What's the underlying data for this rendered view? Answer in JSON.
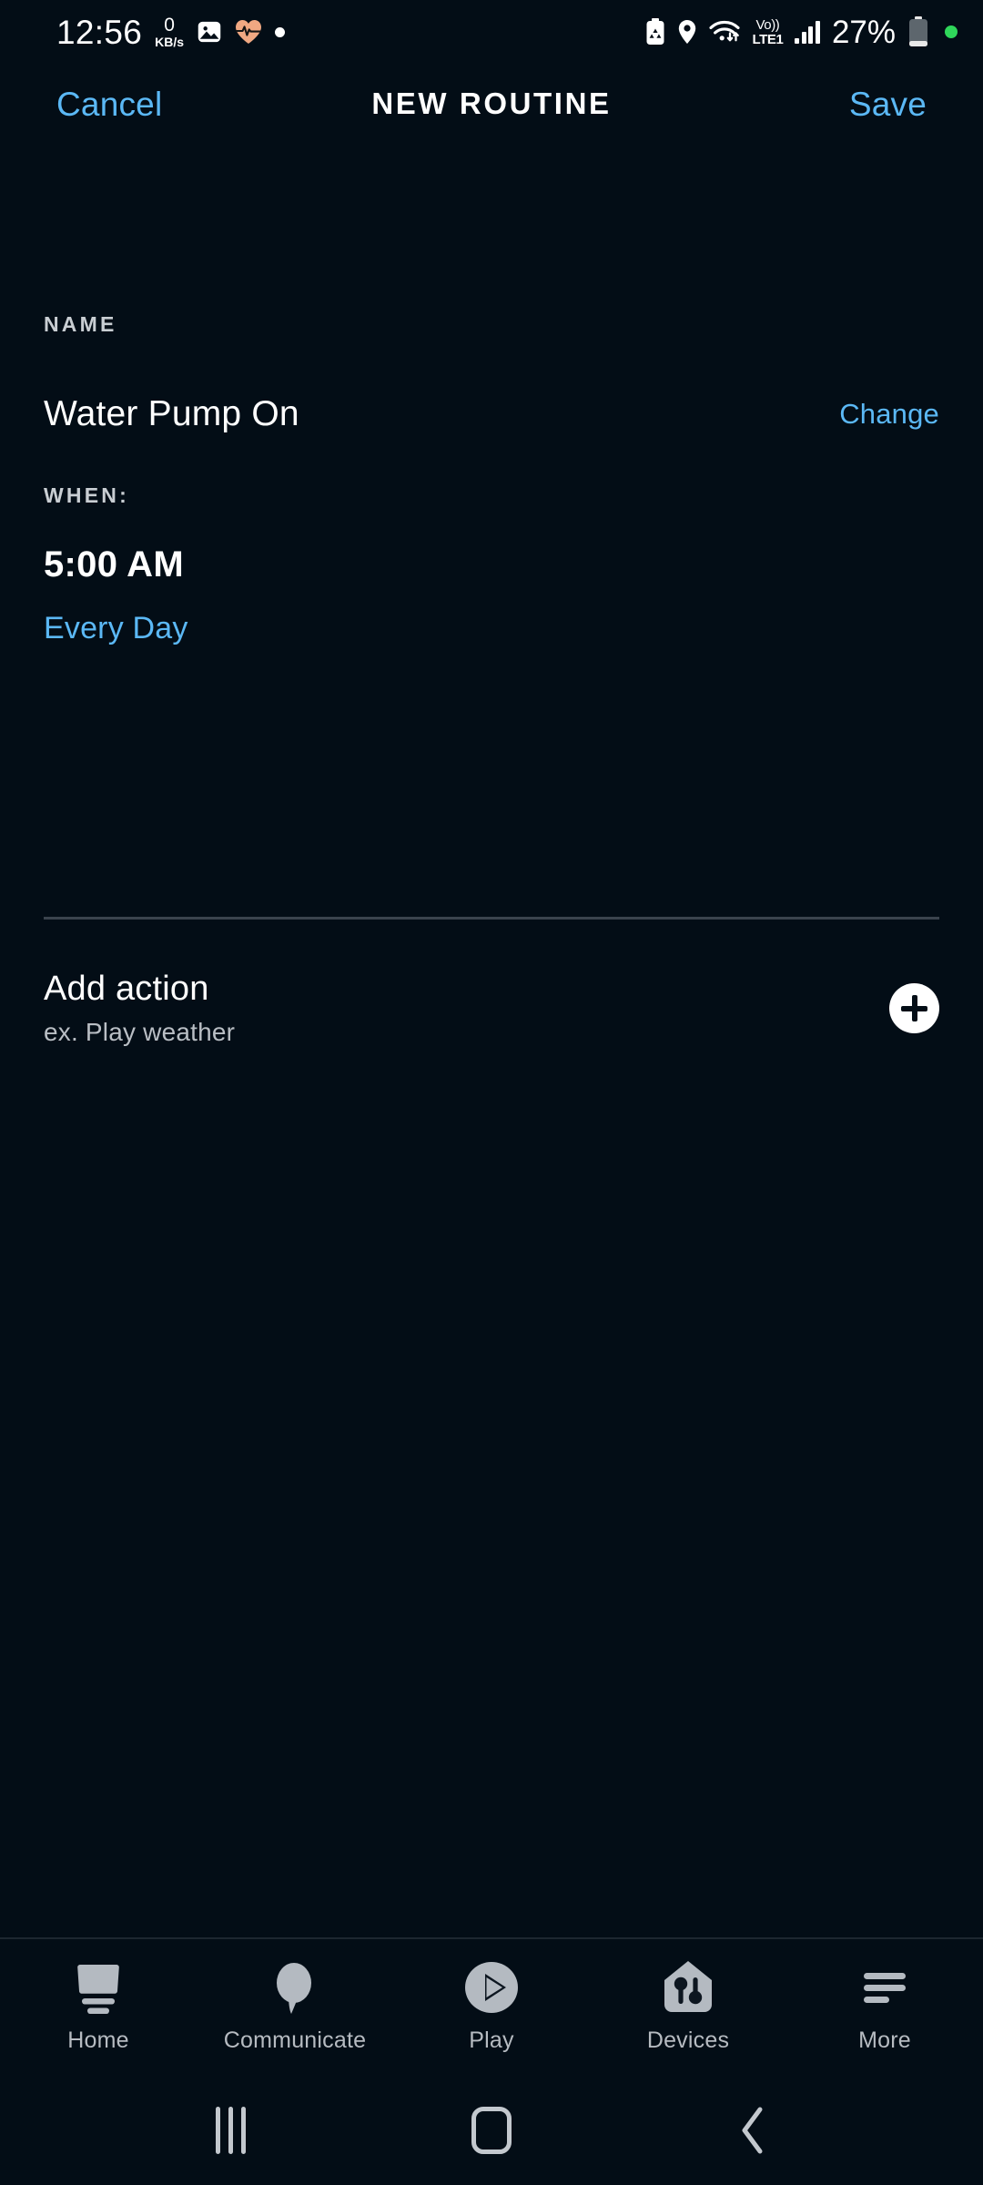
{
  "status_bar": {
    "time": "12:56",
    "network_speed_value": "0",
    "network_speed_unit": "KB/s",
    "battery_percent": "27%",
    "volte_line1": "Vo))",
    "volte_line2": "LTE1",
    "icons_left": [
      "gallery-image-icon",
      "heart-rate-icon",
      "white-dot-icon"
    ],
    "icons_right": [
      "battery-saver-recycle-icon",
      "location-pin-icon",
      "wifi-icon",
      "volte-lte1-icon",
      "cellular-signal-icon",
      "battery-icon",
      "green-dot-icon"
    ]
  },
  "header": {
    "cancel_label": "Cancel",
    "title": "NEW ROUTINE",
    "save_label": "Save"
  },
  "name_section": {
    "label": "NAME",
    "value": "Water Pump On",
    "change_label": "Change"
  },
  "when_section": {
    "label": "WHEN:",
    "time": "5:00 AM",
    "repeat": "Every Day"
  },
  "action_section": {
    "title": "Add action",
    "subtitle": "ex. Play weather",
    "add_button_icon": "plus-icon"
  },
  "tab_bar": {
    "tabs": [
      {
        "label": "Home",
        "icon": "echo-device-icon"
      },
      {
        "label": "Communicate",
        "icon": "speech-bubble-icon"
      },
      {
        "label": "Play",
        "icon": "play-circle-icon"
      },
      {
        "label": "Devices",
        "icon": "house-sliders-icon"
      },
      {
        "label": "More",
        "icon": "hamburger-lines-icon"
      }
    ]
  },
  "nav_bar": {
    "recents_label": "recents-icon",
    "home_label": "home-icon",
    "back_label": "back-icon"
  },
  "colors": {
    "background": "#030d16",
    "accent_blue": "#5bb8f5",
    "primary_text": "#ffffff",
    "secondary_text": "#b6bbc1",
    "divider": "#3a434d",
    "heart_icon": "#f0a882",
    "green_dot": "#2fd65a"
  }
}
